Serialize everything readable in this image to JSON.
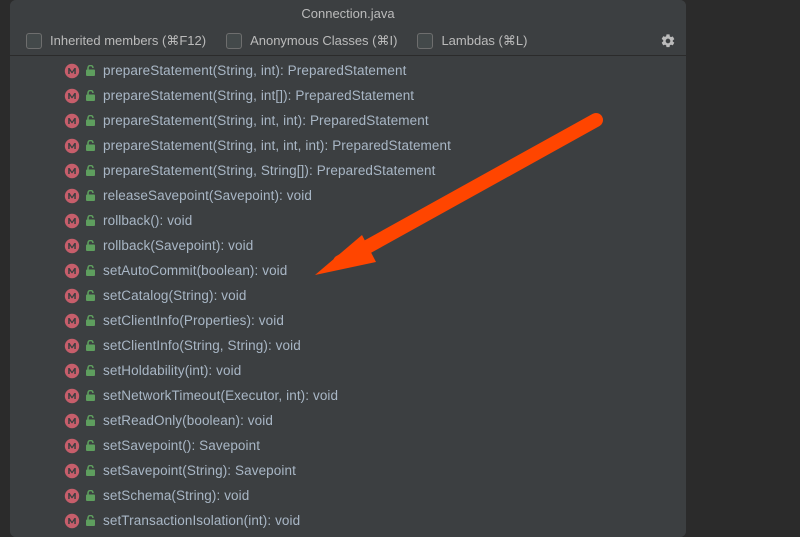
{
  "title": "Connection.java",
  "options": {
    "inherited": "Inherited members (⌘F12)",
    "anonymous": "Anonymous Classes (⌘I)",
    "lambdas": "Lambdas (⌘L)"
  },
  "methods": [
    "prepareStatement(String, int): PreparedStatement",
    "prepareStatement(String, int[]): PreparedStatement",
    "prepareStatement(String, int, int): PreparedStatement",
    "prepareStatement(String, int, int, int): PreparedStatement",
    "prepareStatement(String, String[]): PreparedStatement",
    "releaseSavepoint(Savepoint): void",
    "rollback(): void",
    "rollback(Savepoint): void",
    "setAutoCommit(boolean): void",
    "setCatalog(String): void",
    "setClientInfo(Properties): void",
    "setClientInfo(String, String): void",
    "setHoldability(int): void",
    "setNetworkTimeout(Executor, int): void",
    "setReadOnly(boolean): void",
    "setSavepoint(): Savepoint",
    "setSavepoint(String): Savepoint",
    "setSchema(String): void",
    "setTransactionIsolation(int): void"
  ]
}
